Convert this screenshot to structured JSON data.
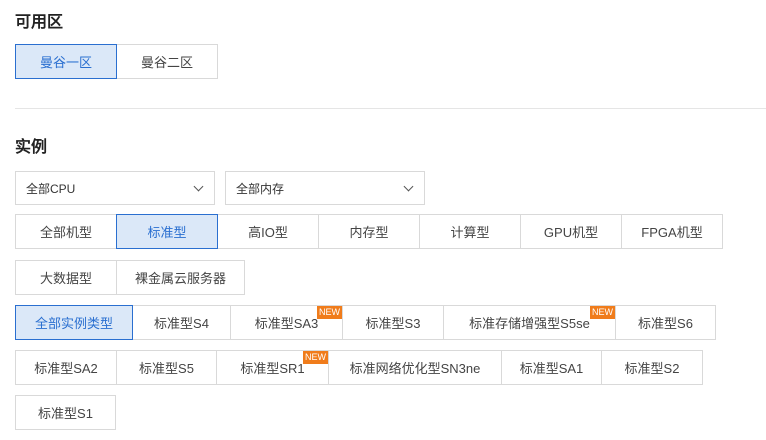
{
  "zone": {
    "title": "可用区",
    "options": [
      "曼谷一区",
      "曼谷二区"
    ],
    "selected": 0
  },
  "instance": {
    "title": "实例",
    "cpu_select": {
      "value": "全部CPU"
    },
    "mem_select": {
      "value": "全部内存"
    },
    "families": [
      "全部机型",
      "标准型",
      "高IO型",
      "内存型",
      "计算型",
      "GPU机型",
      "FPGA机型",
      "大数据型",
      "裸金属云服务器"
    ],
    "types": [
      "全部实例类型",
      "标准型S4",
      "标准型SA3",
      "标准型S3",
      "标准存储增强型S5se",
      "标准型S6",
      "标准型SA2",
      "标准型S5",
      "标准型SR1",
      "标准网络优化型SN3ne",
      "标准型SA1",
      "标准型S2",
      "标准型S1"
    ],
    "new_badge": "NEW"
  },
  "colors": {
    "accent": "#2a6fd0",
    "selected_bg": "#dbe8f8",
    "badge": "#f07c1b"
  }
}
